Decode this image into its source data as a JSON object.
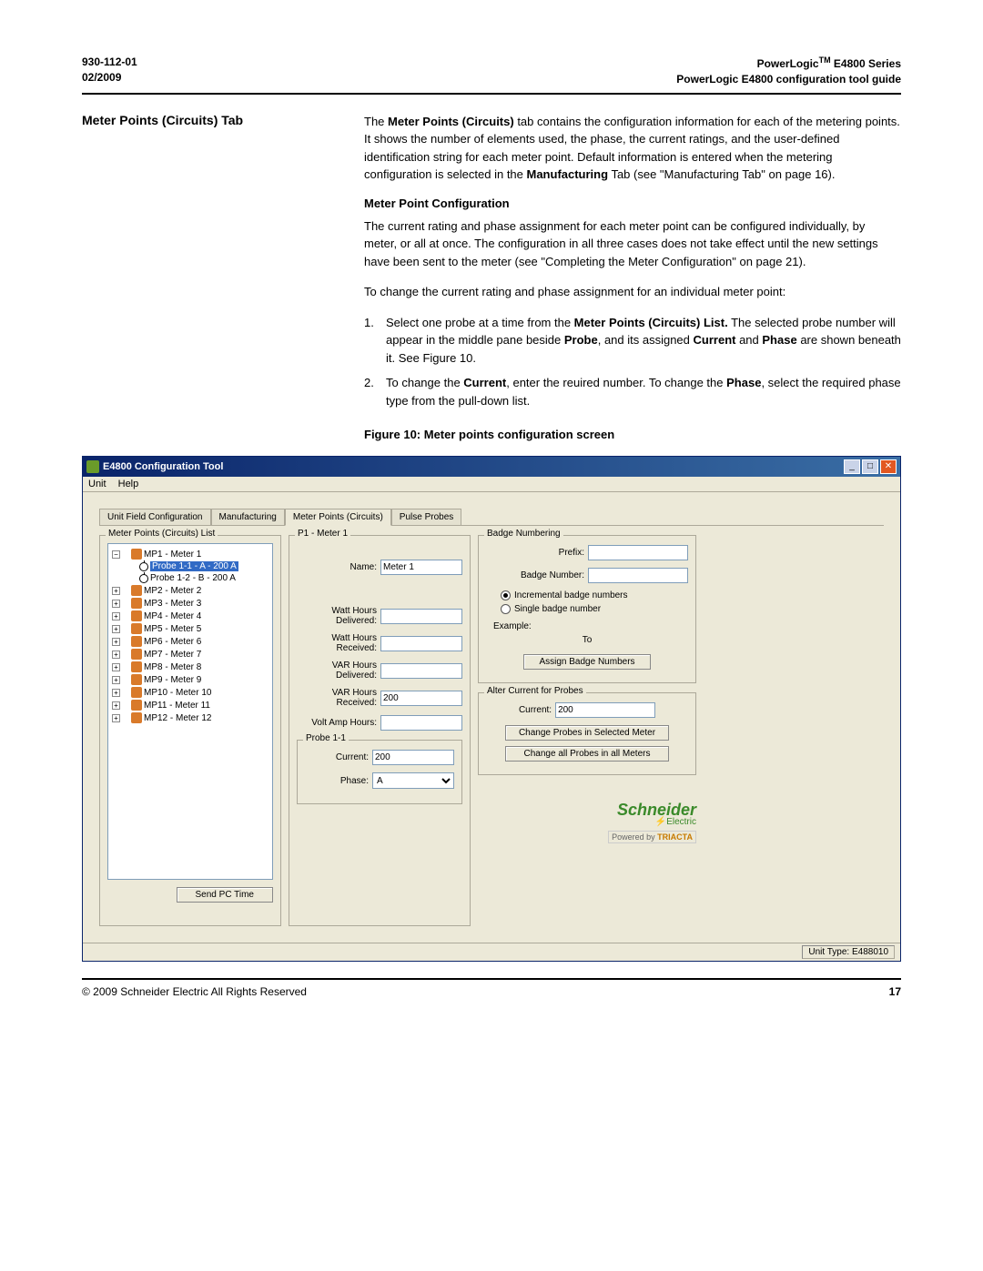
{
  "header": {
    "doc_num": "930-112-01",
    "date": "02/2009",
    "series_prefix": "PowerLogic",
    "series_tm": "TM",
    "series_suffix": " E4800 Series",
    "subtitle": "PowerLogic E4800 configuration tool guide"
  },
  "left_heading": "Meter Points (Circuits) Tab",
  "para1_pre": "The ",
  "para1_bold1": "Meter Points (Circuits)",
  "para1_mid": " tab contains the configuration information for each of the metering points. It shows the number of elements used, the phase, the current ratings, and the user-defined identification string for each meter point. Default information is entered when the metering configuration is selected in the ",
  "para1_bold2": "Manufacturing",
  "para1_post": " Tab (see \"Manufacturing Tab\" on page 16).",
  "sub1": "Meter Point Configuration",
  "para2": "The current rating and phase assignment for each meter point can be configured individually, by meter, or all at once. The configuration in all three cases does not take effect until the new settings have been sent to the meter (see \"Completing the Meter Configuration\" on page 21).",
  "para3": "To change the current rating and phase assignment for an individual meter point:",
  "step1_num": "1.",
  "step1_a": "Select one probe at a time from the ",
  "step1_b1": "Meter Points (Circuits) List.",
  "step1_b": " The selected probe number will appear in the middle pane beside ",
  "step1_b2": "Probe",
  "step1_c": ", and its assigned ",
  "step1_b3": "Current",
  "step1_d": " and ",
  "step1_b4": "Phase",
  "step1_e": " are shown beneath it. See Figure 10.",
  "step2_num": "2.",
  "step2_a": "To change the ",
  "step2_b1": "Current",
  "step2_b": ", enter the reuired number. To change the ",
  "step2_b2": "Phase",
  "step2_c": ", select the required phase type from the pull-down list.",
  "figure_caption": "Figure 10:  Meter points configuration screen",
  "app": {
    "title": "E4800 Configuration Tool",
    "menu": {
      "unit": "Unit",
      "help": "Help"
    },
    "tabs": {
      "t1": "Unit Field Configuration",
      "t2": "Manufacturing",
      "t3": "Meter Points (Circuits)",
      "t4": "Pulse Probes"
    },
    "list_title": "Meter Points (Circuits) List",
    "tree": {
      "mp1": "MP1 - Meter 1",
      "probe1": "Probe 1-1 - A - 200 A",
      "probe2": "Probe 1-2 - B - 200 A",
      "mp2": "MP2 - Meter 2",
      "mp3": "MP3 - Meter 3",
      "mp4": "MP4 - Meter 4",
      "mp5": "MP5 - Meter 5",
      "mp6": "MP6 - Meter 6",
      "mp7": "MP7 - Meter 7",
      "mp8": "MP8 - Meter 8",
      "mp9": "MP9 - Meter 9",
      "mp10": "MP10 - Meter 10",
      "mp11": "MP11 - Meter 11",
      "mp12": "MP12 - Meter 12"
    },
    "mid_title": "P1 - Meter 1",
    "name_label": "Name:",
    "name_value": "Meter 1",
    "whd_label": "Watt Hours Delivered:",
    "whr_label": "Watt Hours Received:",
    "vhd_label": "VAR Hours Delivered:",
    "vhr_label": "VAR Hours Received:",
    "vhr_value": "200",
    "vah_label": "Volt Amp Hours:",
    "probe_title": "Probe 1-1",
    "current_label": "Current:",
    "current_value": "200",
    "phase_label": "Phase:",
    "phase_value": "A",
    "badge_title": "Badge Numbering",
    "prefix_label": "Prefix:",
    "badge_num_label": "Badge Number:",
    "radio1": "Incremental badge numbers",
    "radio2": "Single badge number",
    "example_label": "Example:",
    "to_label": "To",
    "assign_btn": "Assign Badge Numbers",
    "alter_title": "Alter Current for Probes",
    "alter_current_label": "Current:",
    "alter_current_value": "200",
    "change_sel_btn": "Change Probes in Selected Meter",
    "change_all_btn": "Change all Probes in all Meters",
    "send_pc_btn": "Send PC Time",
    "logo_main": "Schneider",
    "logo_sub": "Electric",
    "powered_prefix": "Powered by ",
    "powered_name": "TRIACTA",
    "status": "Unit Type: E488010"
  },
  "footer": {
    "copyright": "© 2009 Schneider Electric All Rights Reserved",
    "page": "17"
  }
}
